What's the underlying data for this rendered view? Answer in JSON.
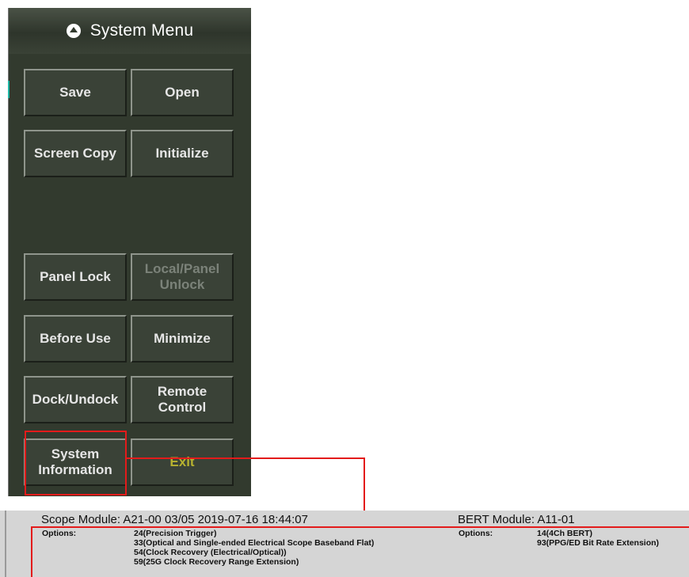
{
  "menu": {
    "title": "System Menu",
    "header_icon": "circle-up-arrow-icon",
    "buttons": {
      "save": "Save",
      "open": "Open",
      "screen_copy": "Screen Copy",
      "initialize": "Initialize",
      "panel_lock": "Panel Lock",
      "local_panel_unlock_line1": "Local/Panel",
      "local_panel_unlock_line2": "Unlock",
      "before_use": "Before Use",
      "minimize": "Minimize",
      "dock_undock": "Dock/Undock",
      "remote_control_line1": "Remote",
      "remote_control_line2": "Control",
      "system_information_line1": "System",
      "system_information_line2": "Information",
      "exit": "Exit"
    },
    "colors": {
      "panel": "#323a2e",
      "highlight": "#e31b1b",
      "exit_text": "#b7b230",
      "disabled_text": "#7b8279"
    }
  },
  "info": {
    "scope_module": "Scope Module: A21-00 03/05 2019-07-16 18:44:07",
    "scope_options_label": "Options:",
    "scope_options": [
      "24(Precision Trigger)",
      "33(Optical and Single-ended Electrical Scope Baseband Flat)",
      "54(Clock Recovery (Electrical/Optical))",
      "59(25G Clock Recovery Range Extension)"
    ],
    "bert_module": "BERT Module: A11-01",
    "bert_options_label": "Options:",
    "bert_options": [
      "14(4Ch BERT)",
      "93(PPG/ED Bit Rate Extension)"
    ]
  }
}
